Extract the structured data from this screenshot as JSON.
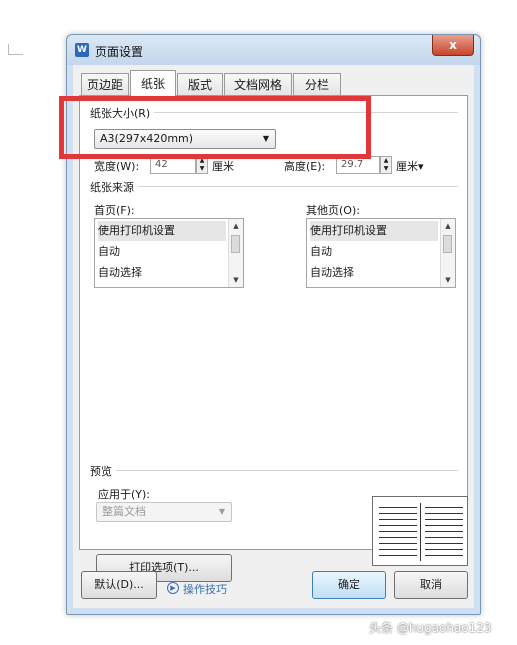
{
  "window": {
    "title": "页面设置",
    "app_icon_glyph": "W",
    "close_glyph": "x"
  },
  "tabs": [
    {
      "label": "页边距"
    },
    {
      "label": "纸张",
      "active": true
    },
    {
      "label": "版式"
    },
    {
      "label": "文档网格"
    },
    {
      "label": "分栏"
    }
  ],
  "paper_size": {
    "group_label": "纸张大小(R)",
    "selected": "A3(297x420mm)",
    "width_label": "宽度(W):",
    "width_value": "42",
    "width_unit": "厘米",
    "height_label": "高度(E):",
    "height_value": "29.7",
    "height_unit": "厘米▾"
  },
  "paper_source": {
    "group_label": "纸张来源",
    "first_page_label": "首页(F):",
    "other_pages_label": "其他页(O):",
    "first_page_options": [
      "使用打印机设置",
      "自动",
      "自动选择"
    ],
    "other_pages_options": [
      "使用打印机设置",
      "自动",
      "自动选择"
    ]
  },
  "preview": {
    "group_label": "预览",
    "apply_to_label": "应用于(Y):",
    "apply_to_value": "整篇文档",
    "print_options_button": "打印选项(T)..."
  },
  "footer": {
    "default_button": "默认(D)...",
    "tips_link": "操作技巧",
    "ok_button": "确定",
    "cancel_button": "取消"
  },
  "watermark": {
    "text": "头条 @hugaohao123"
  },
  "colors": {
    "highlight": "#e2373a",
    "link": "#3a6fb0",
    "frame": "#cfe0f1"
  }
}
